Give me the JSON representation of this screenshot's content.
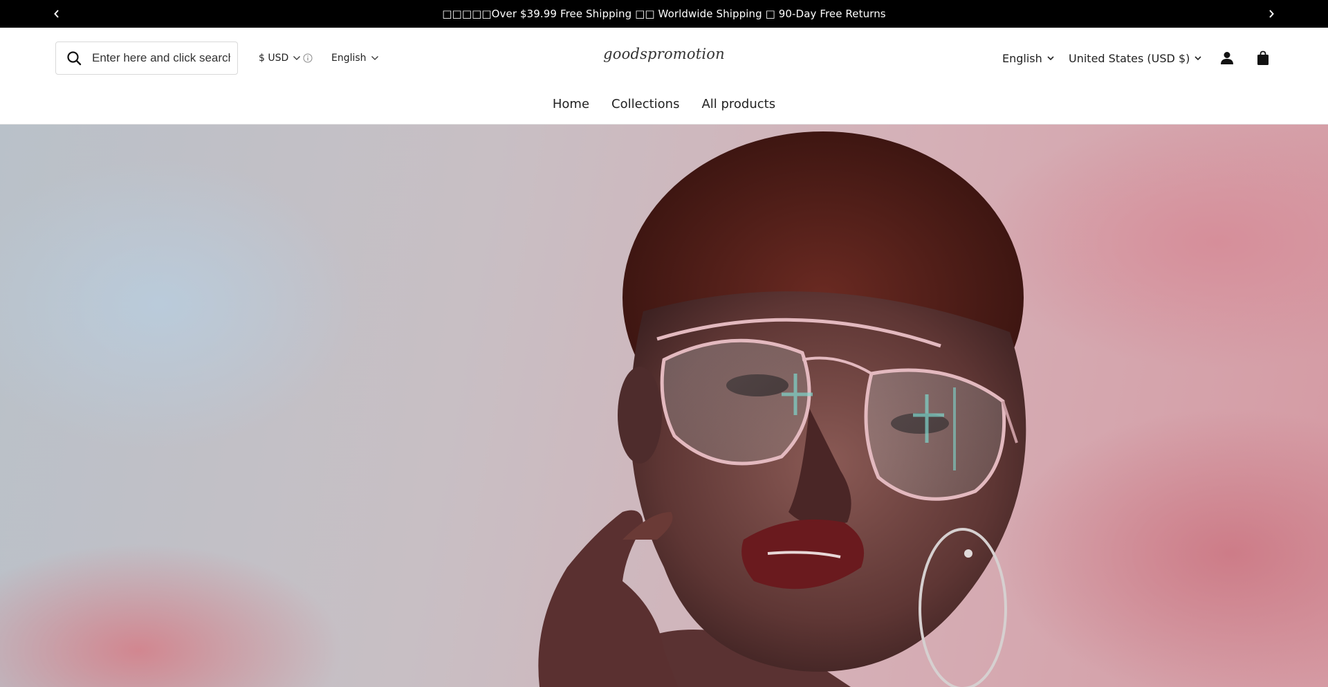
{
  "announcement": {
    "text": "□□□□□Over $39.99 Free Shipping □□ Worldwide Shipping □ 90-Day Free Returns",
    "prev_icon": "chevron-left-icon",
    "next_icon": "chevron-right-icon"
  },
  "header": {
    "search": {
      "placeholder": "Enter here and click search",
      "value": "",
      "icon": "search-icon"
    },
    "currency": {
      "label": "$ USD",
      "icon": "chevron-down-icon",
      "info_icon": "info-icon"
    },
    "language": {
      "label": "English",
      "icon": "chevron-down-icon"
    },
    "logo": "goodspromotion",
    "language_right": {
      "label": "English",
      "icon": "chevron-down-icon"
    },
    "country": {
      "label": "United States (USD $)",
      "icon": "chevron-down-icon"
    },
    "account_icon": "account-icon",
    "cart_icon": "cart-icon"
  },
  "nav": {
    "items": [
      {
        "label": "Home"
      },
      {
        "label": "Collections"
      },
      {
        "label": "All products"
      }
    ]
  },
  "hero": {
    "image": "portrait-woman-glasses"
  },
  "colors": {
    "announcement_bg": "#000000",
    "announcement_text": "#ffffff",
    "header_bg": "#ffffff",
    "text": "#222222"
  }
}
